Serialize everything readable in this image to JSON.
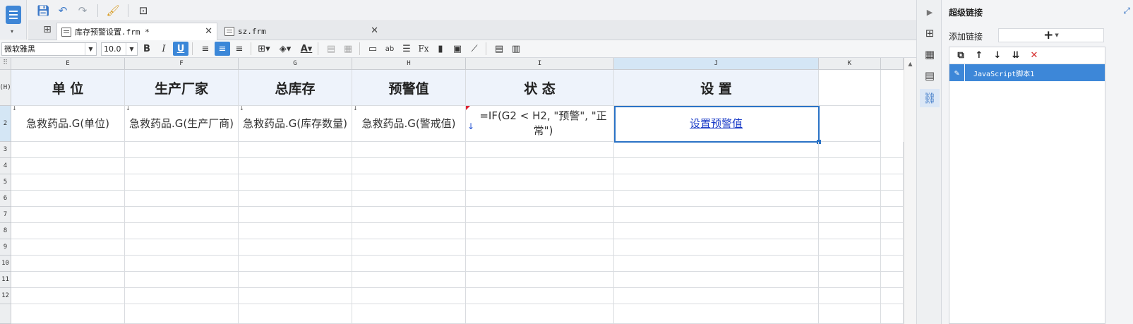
{
  "tabs": [
    {
      "label": "库存预警设置.frm *"
    },
    {
      "label": "sz.frm"
    }
  ],
  "format": {
    "font": "微软雅黑",
    "size": "10.0"
  },
  "columns": [
    "E",
    "F",
    "G",
    "H",
    "I",
    "J",
    "K"
  ],
  "rows": [
    "(H)",
    "2",
    "3",
    "4",
    "5",
    "6",
    "7",
    "8",
    "9",
    "10",
    "11",
    "12"
  ],
  "header_cells": [
    "单 位",
    "生产厂家",
    "总库存",
    "预警值",
    "状 态",
    "设 置"
  ],
  "data_cells": [
    "急救药品.G(单位)",
    "急救药品.G(生产厂商)",
    "急救药品.G(库存数量)",
    "急救药品.G(警戒值)",
    "=IF(G2 < H2, \"预警\", \"正常\")",
    "设置预警值"
  ],
  "panel": {
    "title": "超级链接",
    "add_label": "添加链接",
    "add_symbol": "+",
    "items": [
      "JavaScript脚本1"
    ]
  },
  "icons": {
    "toolbar": [
      "save-icon",
      "undo-icon",
      "redo-icon",
      "format-brush-icon",
      "preview-icon"
    ],
    "accent": "#3b87d8"
  }
}
